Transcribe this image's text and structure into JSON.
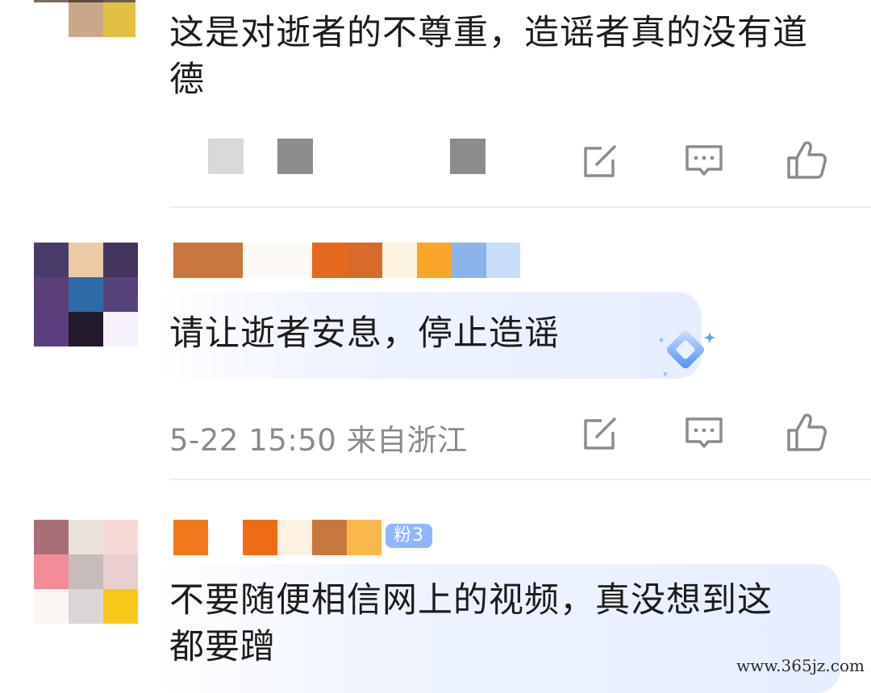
{
  "comments": [
    {
      "text": "这是对逝者的不尊重，造谣者真的没有道德",
      "meta": ""
    },
    {
      "text": "请让逝者安息，停止造谣",
      "meta": "5-22 15:50 来自浙江"
    },
    {
      "text": "不要随便相信网上的视频，真没想到这都要蹭",
      "badge": "粉3"
    }
  ],
  "actions": {
    "repost_icon": "share-edit-icon",
    "comment_icon": "comment-bubble-icon",
    "like_icon": "thumbs-up-icon"
  },
  "colors": {
    "bubble": "#e6eeff",
    "meta": "#8a8a8a",
    "icon": "#8c8c8c",
    "badge": "#8fb6ff"
  },
  "watermark": "www.365jz.com"
}
